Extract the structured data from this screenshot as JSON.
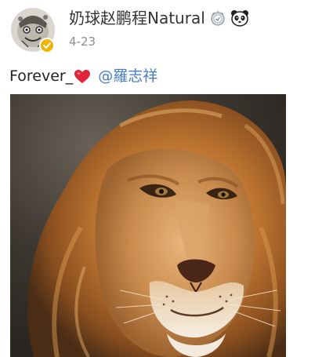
{
  "post": {
    "username": "奶球赵鹏程Natural",
    "timestamp": "4-23",
    "text": "Forever_",
    "mention": "@羅志祥"
  },
  "icons": {
    "avatar": "avatar-image",
    "verified": "verified-badge-icon",
    "medal": "medal-icon",
    "panda": "panda-icon",
    "heart": "red-heart-icon"
  },
  "colors": {
    "username": "#333333",
    "timestamp": "#8c8c8c",
    "mention": "#4a7ec4",
    "heart": "#e0243a",
    "verified": "#f2b400"
  },
  "image": {
    "subject": "lion"
  }
}
